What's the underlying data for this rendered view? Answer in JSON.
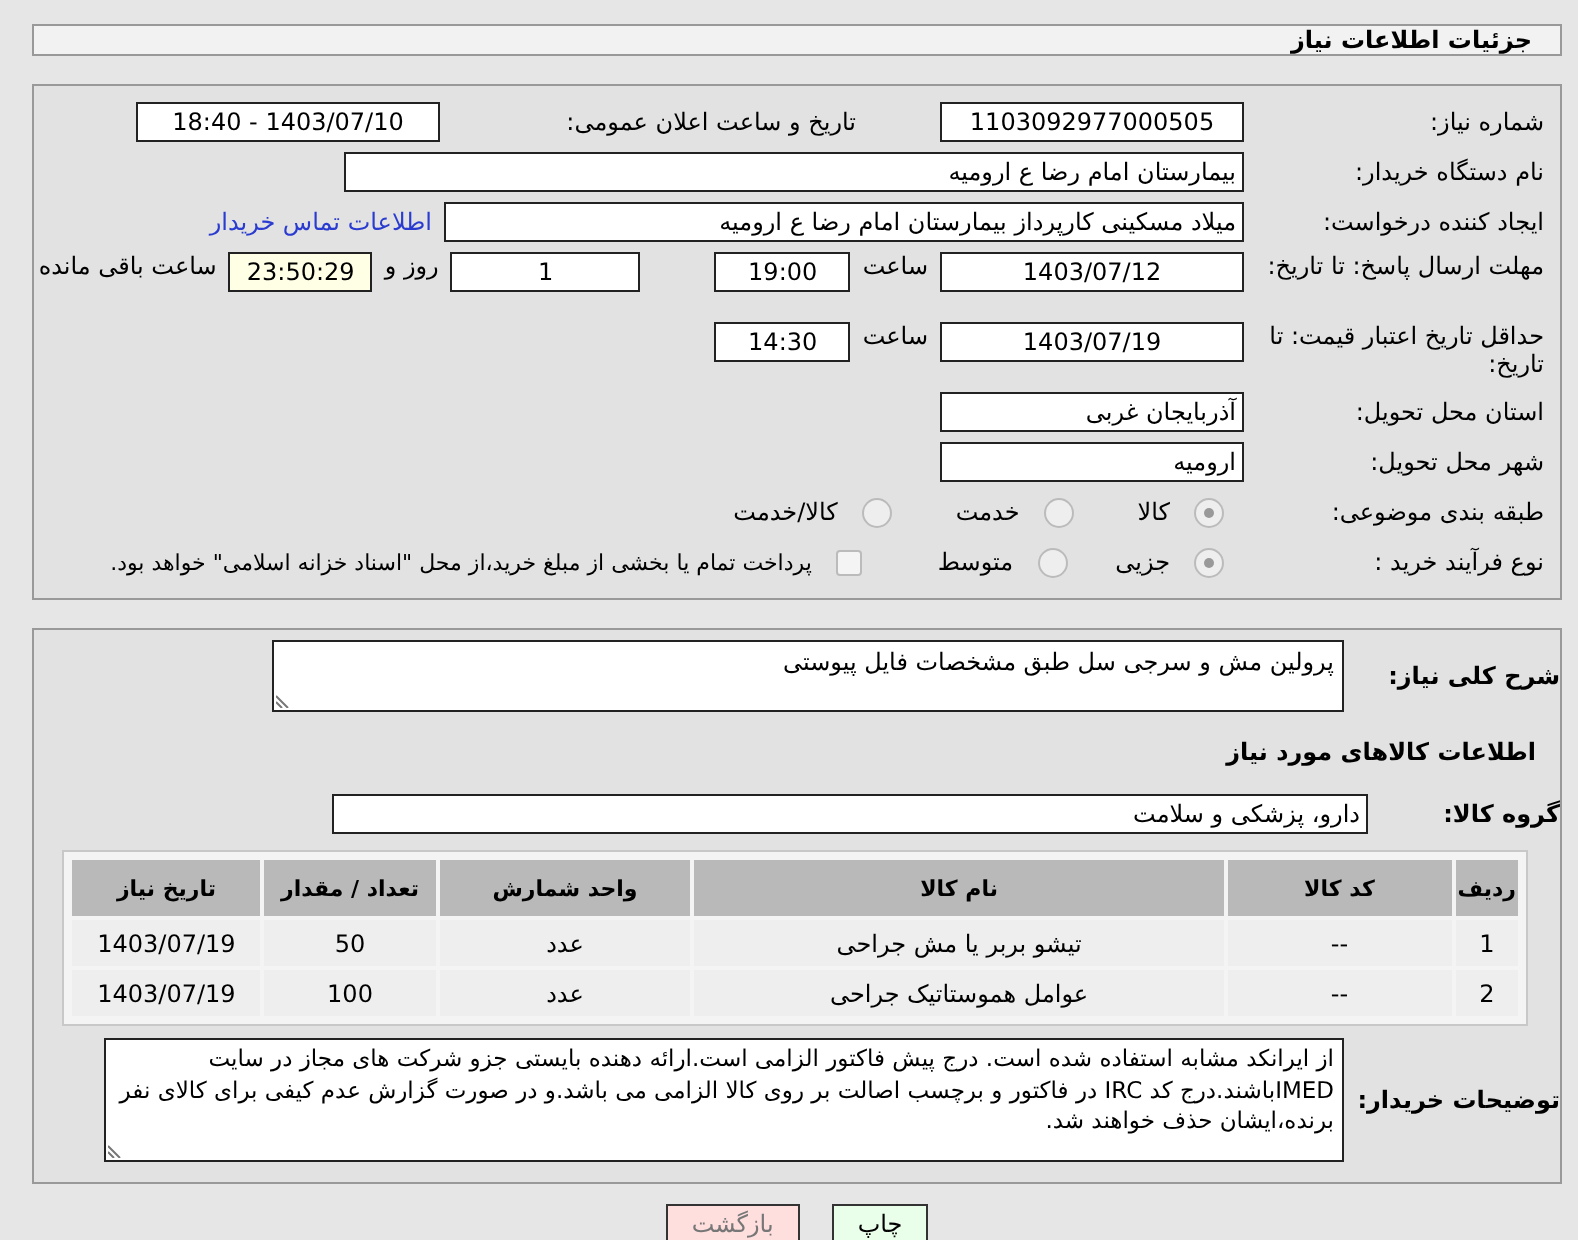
{
  "page_title": "جزئیات اطلاعات نیاز",
  "need_number": {
    "label": "شماره نیاز:",
    "value": "1103092977000505"
  },
  "announce": {
    "label": "تاریخ و ساعت اعلان عمومی:",
    "value": "1403/07/10 - 18:40"
  },
  "buyer": {
    "label": "نام دستگاه خریدار:",
    "value": "بیمارستان امام رضا  ع  ارومیه"
  },
  "requester": {
    "label": "ایجاد کننده درخواست:",
    "value": "میلاد مسکینی کارپرداز بیمارستان امام رضا  ع  ارومیه",
    "link": "اطلاعات تماس خریدار"
  },
  "reply_deadline": {
    "label": "مهلت ارسال پاسخ: تا تاریخ:",
    "date": "1403/07/12",
    "time_label": "ساعت",
    "time": "19:00",
    "days": "1",
    "days_label": "روز و",
    "remaining": "23:50:29",
    "remaining_label": "ساعت باقی مانده"
  },
  "price_validity": {
    "label": "حداقل تاریخ اعتبار قیمت: تا تاریخ:",
    "date": "1403/07/19",
    "time_label": "ساعت",
    "time": "14:30"
  },
  "province": {
    "label": "استان محل تحویل:",
    "value": "آذربایجان غربی"
  },
  "city": {
    "label": "شهر محل تحویل:",
    "value": "ارومیه"
  },
  "category": {
    "label": "طبقه بندی موضوعی:",
    "options": [
      {
        "label": "کالا",
        "selected": true
      },
      {
        "label": "خدمت",
        "selected": false
      },
      {
        "label": "کالا/خدمت",
        "selected": false
      }
    ]
  },
  "process": {
    "label": "نوع فرآیند خرید :",
    "options": [
      {
        "label": "جزیی",
        "selected": true
      },
      {
        "label": "متوسط",
        "selected": false
      }
    ],
    "payment": {
      "label": "پرداخت تمام یا بخشی از مبلغ خرید،از محل \"اسناد خزانه اسلامی\" خواهد بود.",
      "checked": false
    }
  },
  "description": {
    "label": "شرح کلی نیاز:",
    "value": "پرولین مش و سرجی سل طبق مشخصات فایل پیوستی"
  },
  "goods_heading": "اطلاعات کالاهای مورد نیاز",
  "group": {
    "label": "گروه کالا:",
    "value": "دارو، پزشکی و سلامت"
  },
  "table": {
    "columns": [
      "ردیف",
      "کد کالا",
      "نام کالا",
      "واحد شمارش",
      "تعداد / مقدار",
      "تاریخ نیاز"
    ],
    "rows": [
      [
        "1",
        "--",
        "تیشو بربر یا مش جراحی",
        "عدد",
        "50",
        "1403/07/19"
      ],
      [
        "2",
        "--",
        "عوامل هموستاتیک جراحی",
        "عدد",
        "100",
        "1403/07/19"
      ]
    ]
  },
  "notes": {
    "label": "توضیحات خریدار:",
    "value": "از ایرانکد مشابه استفاده شده است. درج پیش فاکتور الزامی است.ارائه دهنده بایستی جزو شرکت های مجاز در سایت IMEDباشند.درج کد IRC در فاکتور و برچسب اصالت بر روی کالا الزامی می باشد.و در صورت گزارش عدم کیفی برای کالای نفر برنده،ایشان حذف خواهند شد."
  },
  "buttons": [
    {
      "label": "چاپ",
      "kind": "print"
    },
    {
      "label": "بازگشت",
      "kind": "back"
    }
  ]
}
